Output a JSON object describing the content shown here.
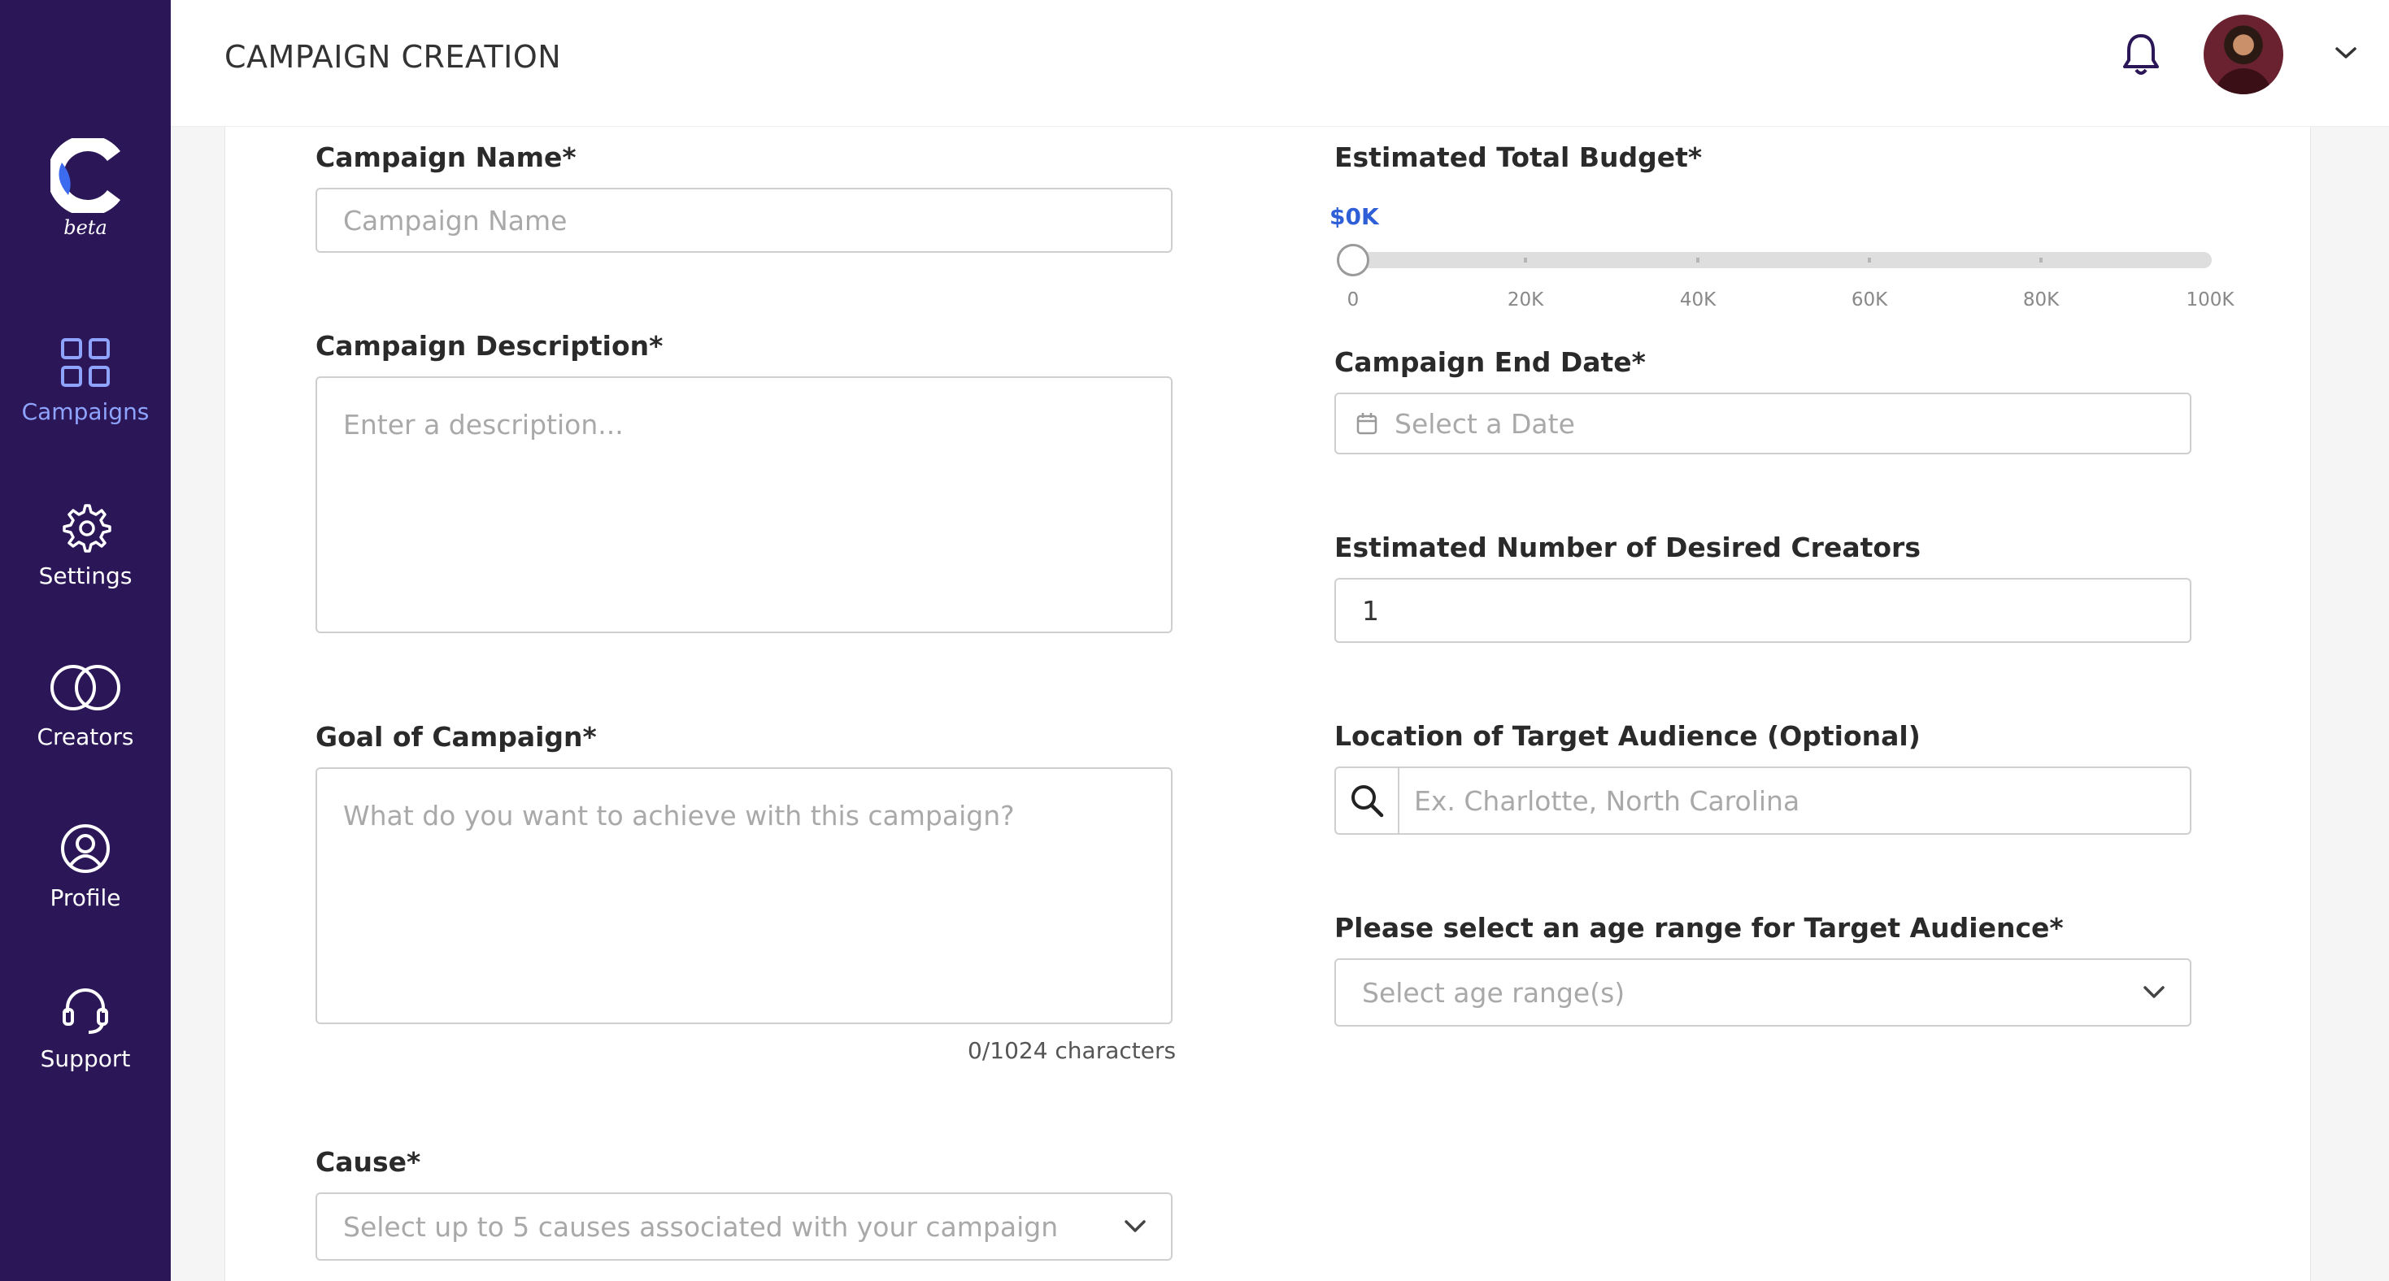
{
  "app": {
    "logo_letter": "C",
    "logo_tag": "beta"
  },
  "sidebar": {
    "items": [
      {
        "label": "Campaigns",
        "icon": "grid-icon",
        "active": true
      },
      {
        "label": "Settings",
        "icon": "gear-icon",
        "active": false
      },
      {
        "label": "Creators",
        "icon": "overlapping-circles-icon",
        "active": false
      },
      {
        "label": "Profile",
        "icon": "user-circle-icon",
        "active": false
      },
      {
        "label": "Support",
        "icon": "headset-icon",
        "active": false
      }
    ]
  },
  "header": {
    "title": "CAMPAIGN CREATION",
    "notification_icon": "bell-icon",
    "menu_icon": "chevron-down-icon"
  },
  "form": {
    "campaign_name": {
      "label": "Campaign Name*",
      "placeholder": "Campaign Name",
      "value": ""
    },
    "description": {
      "label": "Campaign Description*",
      "placeholder": "Enter a description...",
      "value": ""
    },
    "goal": {
      "label": "Goal of Campaign*",
      "placeholder": "What do you want to achieve with this campaign?",
      "value": "",
      "counter": "0/1024 characters"
    },
    "cause": {
      "label": "Cause*",
      "placeholder": "Select up to 5 causes associated with your campaign"
    },
    "budget": {
      "label": "Estimated Total Budget*",
      "display": "$0K",
      "value_k": 0,
      "min_k": 0,
      "max_k": 100,
      "marks": [
        "0",
        "20K",
        "40K",
        "60K",
        "80K",
        "100K"
      ]
    },
    "end_date": {
      "label": "Campaign End Date*",
      "placeholder": "Select a Date"
    },
    "creators": {
      "label": "Estimated Number of Desired Creators",
      "value": "1"
    },
    "location": {
      "label": "Location of Target Audience (Optional)",
      "placeholder": "Ex. Charlotte, North Carolina"
    },
    "age_range": {
      "label": "Please select an age range for Target Audience*",
      "placeholder": "Select age range(s)"
    }
  },
  "colors": {
    "sidebar_bg": "#2b1757",
    "accent_blue": "#2f5fd6",
    "active_nav": "#8fa4ff"
  }
}
